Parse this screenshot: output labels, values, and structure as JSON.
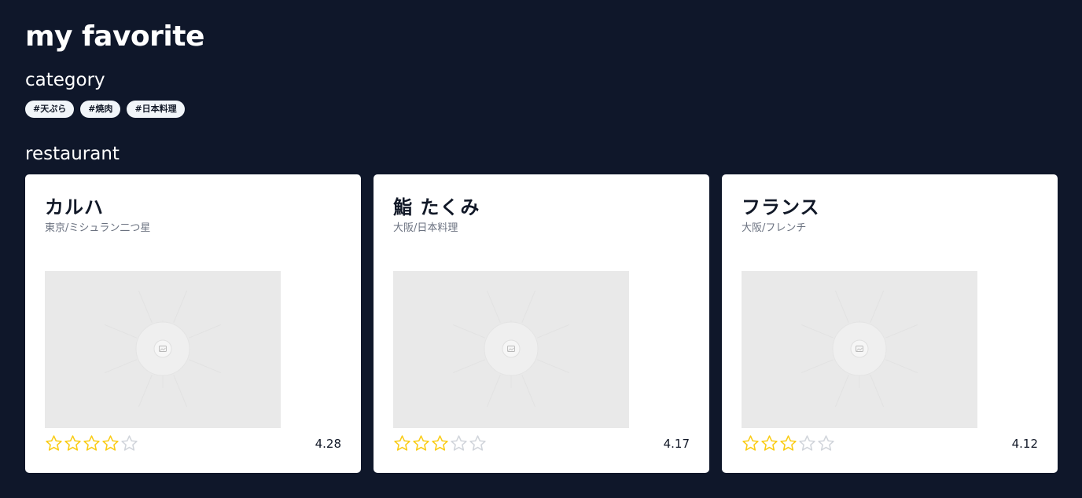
{
  "page": {
    "title": "my favorite"
  },
  "category": {
    "heading": "category",
    "tags": [
      "#天ぷら",
      "#焼肉",
      "#日本料理"
    ]
  },
  "restaurant": {
    "heading": "restaurant",
    "cards": [
      {
        "name": "カルハ",
        "subtitle": "東京/ミシュラン二つ星",
        "stars_filled": 4,
        "stars_total": 5,
        "rating": "4.28",
        "image_icon": "image-placeholder-icon"
      },
      {
        "name": "鮨 たくみ",
        "subtitle": "大阪/日本料理",
        "stars_filled": 3,
        "stars_total": 5,
        "rating": "4.17",
        "image_icon": "image-placeholder-icon"
      },
      {
        "name": "フランス",
        "subtitle": "大阪/フレンチ",
        "stars_filled": 3,
        "stars_total": 5,
        "rating": "4.12",
        "image_icon": "image-placeholder-icon"
      }
    ]
  },
  "colors": {
    "background": "#0f172a",
    "star_filled": "#facc15",
    "star_empty": "#d1d5db",
    "tag_background": "#f1f5f9"
  },
  "icons": {
    "star": "star-icon",
    "image": "image-placeholder-icon"
  }
}
